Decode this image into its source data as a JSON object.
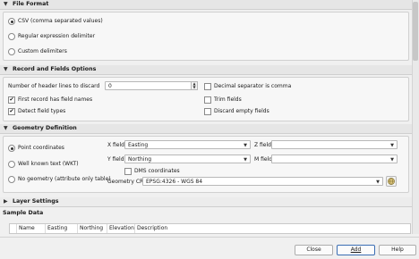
{
  "file_format": {
    "header": "File Format",
    "options": [
      {
        "label": "CSV (comma separated values)",
        "selected": true
      },
      {
        "label": "Regular expression delimiter",
        "selected": false
      },
      {
        "label": "Custom delimiters",
        "selected": false
      }
    ]
  },
  "record_fields": {
    "header": "Record and Fields Options",
    "header_lines_label": "Number of header lines to discard",
    "header_lines_value": "0",
    "first_record_label": "First record has field names",
    "first_record_checked": true,
    "detect_types_label": "Detect field types",
    "detect_types_checked": true,
    "decimal_comma_label": "Decimal separator is comma",
    "decimal_comma_checked": false,
    "trim_fields_label": "Trim fields",
    "trim_fields_checked": false,
    "discard_empty_label": "Discard empty fields",
    "discard_empty_checked": false
  },
  "geometry": {
    "header": "Geometry Definition",
    "options": [
      {
        "label": "Point coordinates",
        "selected": true
      },
      {
        "label": "Well known text (WKT)",
        "selected": false
      },
      {
        "label": "No geometry (attribute only table)",
        "selected": false
      }
    ],
    "x_field_label": "X field",
    "x_field_value": "Easting",
    "y_field_label": "Y field",
    "y_field_value": "Northing",
    "z_field_label": "Z field",
    "z_field_value": "",
    "m_field_label": "M field",
    "m_field_value": "",
    "dms_label": "DMS coordinates",
    "dms_checked": false,
    "crs_label": "Geometry CRS",
    "crs_value": "EPSG:4326 - WGS 84"
  },
  "layer_settings": {
    "header": "Layer Settings"
  },
  "sample_data": {
    "header": "Sample Data",
    "columns": [
      "Name",
      "Easting",
      "Northing",
      "Elevation",
      "Description"
    ]
  },
  "buttons": {
    "close": "Close",
    "add": "Add",
    "help": "Help"
  },
  "colors": {
    "accent": "#3a6db3"
  }
}
